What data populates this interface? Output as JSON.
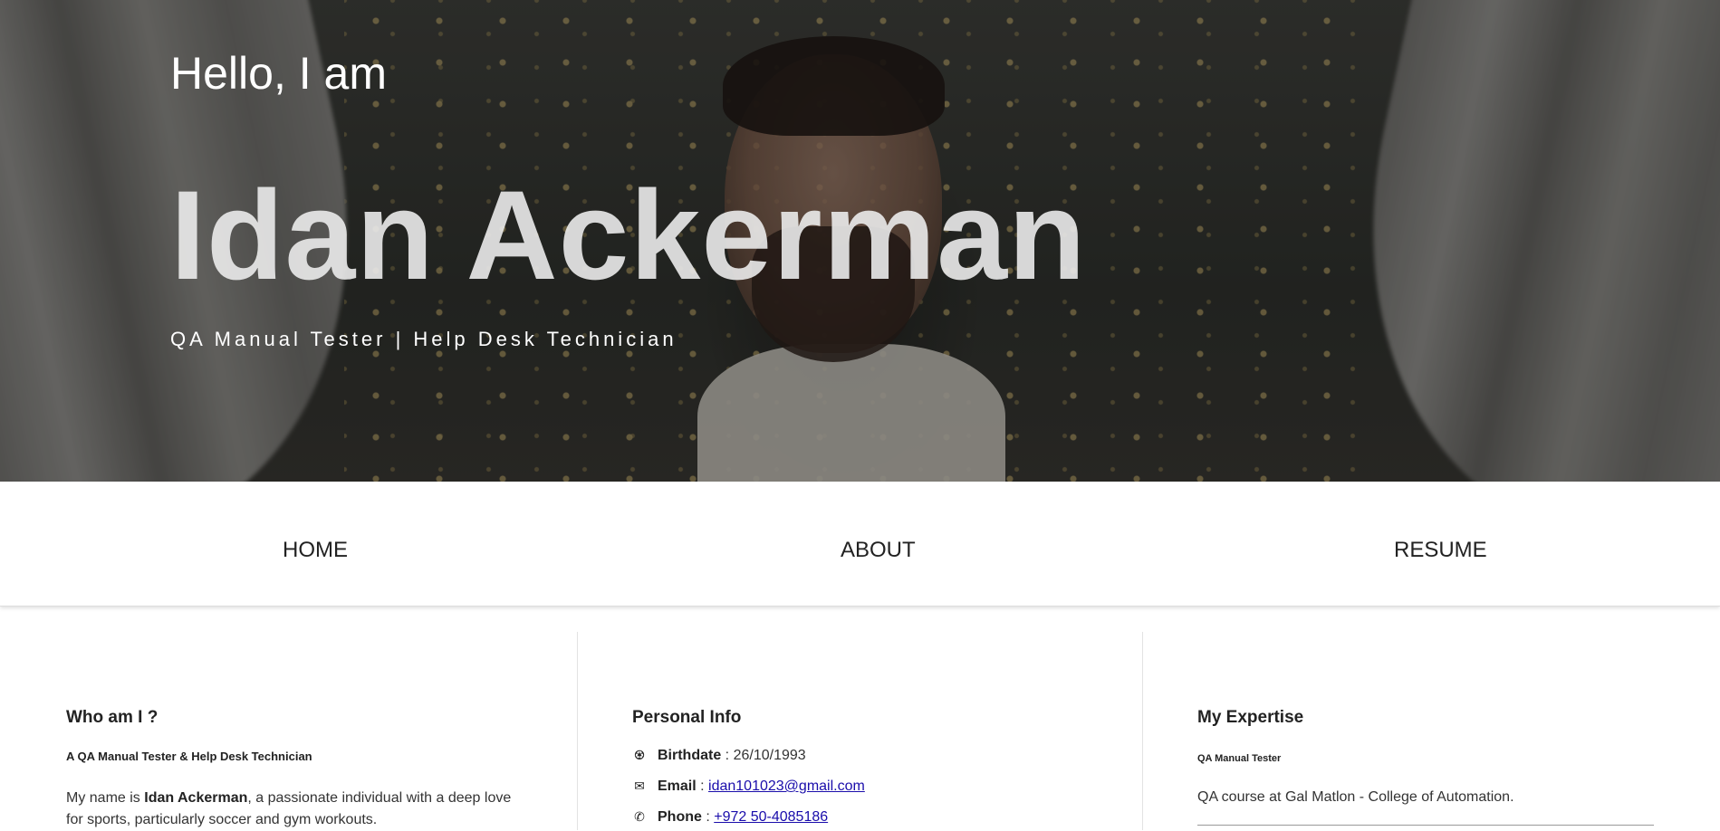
{
  "hero": {
    "greeting": "Hello, I am",
    "name": "Idan Ackerman",
    "tagline": "QA Manual Tester | Help Desk Technician"
  },
  "nav": {
    "items": [
      {
        "label": "HOME"
      },
      {
        "label": "ABOUT"
      },
      {
        "label": "RESUME"
      }
    ]
  },
  "about": {
    "title": "Who am I ?",
    "subtitle": "A QA Manual Tester & Help Desk Technician",
    "bio_prefix": "My name is ",
    "bio_name": "Idan Ackerman",
    "bio_suffix": ", a passionate individual with a deep love for sports, particularly soccer and gym workouts."
  },
  "personal_info": {
    "title": "Personal Info",
    "birthdate_label": "Birthdate",
    "birthdate_sep": " : ",
    "birthdate_value": "26/10/1993",
    "email_label": "Email",
    "email_sep": " : ",
    "email_value": "idan101023@gmail.com",
    "phone_label": "Phone",
    "phone_sep": " : ",
    "phone_value": "+972 50-4085186",
    "icons": [
      "birthday-cake-icon",
      "envelope-icon",
      "phone-icon"
    ]
  },
  "expertise": {
    "title": "My Expertise",
    "item_title": "QA Manual Tester",
    "item_text": "QA course at Gal Matlon - College of Automation."
  },
  "colors": {
    "nav_text": "#222222",
    "link": "#1a0dab",
    "hero_text": "#ffffff"
  }
}
